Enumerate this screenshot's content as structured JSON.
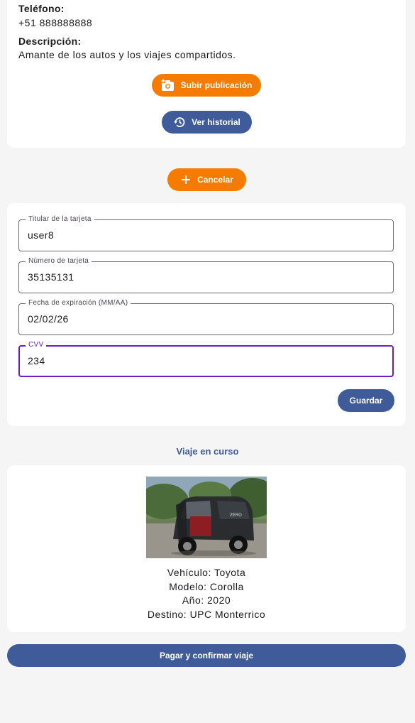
{
  "profile": {
    "phone_label": "Teléfono:",
    "phone_value": "+51 888888888",
    "description_label": "Descripción:",
    "description_value": "Amante de los autos y los viajes compartidos.",
    "upload_button": "Subir publicación",
    "history_button": "Ver historial"
  },
  "cancel_button": "Cancelar",
  "card_form": {
    "holder": {
      "label": "Titular de la tarjeta",
      "value": "user8"
    },
    "number": {
      "label": "Número de tarjeta",
      "value": "35135131"
    },
    "expiry": {
      "label": "Fecha de expiración (MM/AA)",
      "value": "02/02/26"
    },
    "cvv": {
      "label": "CVV",
      "value": "234"
    },
    "save_button": "Guardar"
  },
  "trip": {
    "title": "Viaje en curso",
    "vehicle": "Vehículo: Toyota",
    "model": "Modelo: Corolla",
    "year": "Año: 2020",
    "destination": "Destino: UPC Monterrico"
  },
  "pay_button": "Pagar y confirmar viaje",
  "colors": {
    "accent_orange": "#f57c00",
    "primary_blue": "#3f5b9a",
    "focus_purple": "#6a1fc0"
  }
}
